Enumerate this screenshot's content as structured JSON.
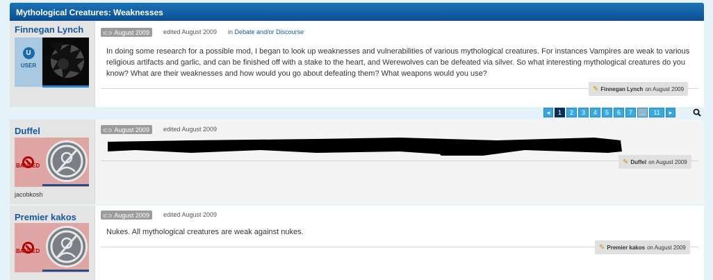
{
  "thread": {
    "title": "Mythological Creatures: Weaknesses"
  },
  "posts": [
    {
      "author": "Finnegan Lynch",
      "role": "USER",
      "role_icon": "U",
      "date": "August 2009",
      "edited": "edited August 2009",
      "category_prefix": "in",
      "category": "Debate and/or Discourse",
      "body": "In doing some research for a possible mod, I began to look up weaknesses and vulnerabilities of various mythological creatures. For instances Vampires are weak to various religious artifacts and garlic, and can be finished off with a stake to the heart, and Werewolves can be defeated via silver. So what interesting mythological creatures do you know? What are their weaknesses and how would you go about defeating them? What weapons would you use?",
      "signature_name": "Finnegan Lynch",
      "signature_date": "on August 2009"
    },
    {
      "author": "Duffel",
      "role": "BANNED",
      "extra": "jacobkosh",
      "date": "August 2009",
      "edited": "edited August 2009",
      "body": "",
      "signature_name": "Duffel",
      "signature_date": "on August 2009"
    },
    {
      "author": "Premier kakos",
      "role": "BANNED",
      "date": "August 2009",
      "edited": "edited August 2009",
      "body": "Nukes. All mythological creatures are weak against nukes.",
      "signature_name": "Premier kakos",
      "signature_date": "on August 2009"
    }
  ],
  "pagination": {
    "pages": [
      "1",
      "2",
      "3",
      "4",
      "5",
      "6",
      "7",
      "...",
      "11"
    ],
    "current": "1"
  },
  "colors": {
    "header": "#0b4f8f",
    "link": "#16589a",
    "banned": "#b30000",
    "page_current": "#0e2f55",
    "page": "#39aae0"
  }
}
